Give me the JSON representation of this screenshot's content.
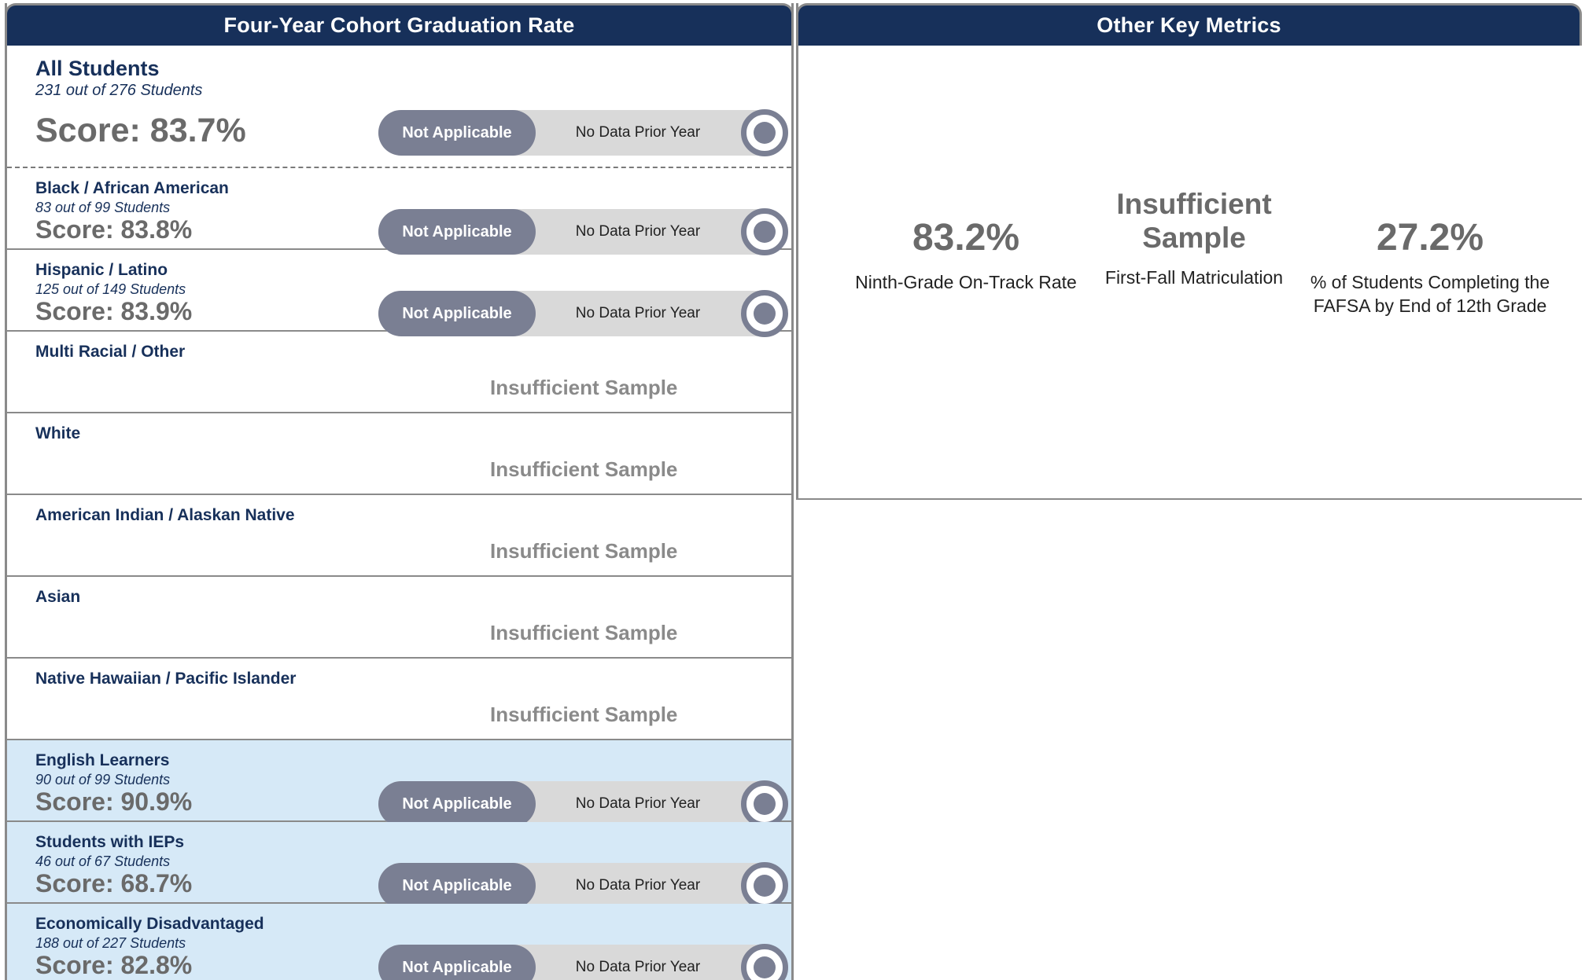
{
  "left_panel": {
    "title": "Four-Year Cohort Graduation Rate",
    "groups": [
      {
        "name": "All Students",
        "count": "231 out of 276 Students",
        "score": "Score: 83.7%",
        "na_label": "Not Applicable",
        "nodata_label": "No Data Prior Year"
      },
      {
        "name": "Black / African American",
        "count": "83 out of 99 Students",
        "score": "Score: 83.8%",
        "na_label": "Not Applicable",
        "nodata_label": "No Data Prior Year"
      },
      {
        "name": "Hispanic / Latino",
        "count": "125 out of 149 Students",
        "score": "Score: 83.9%",
        "na_label": "Not Applicable",
        "nodata_label": "No Data Prior Year"
      },
      {
        "name": "Multi Racial / Other",
        "insufficient": "Insufficient Sample"
      },
      {
        "name": "White",
        "insufficient": "Insufficient Sample"
      },
      {
        "name": "American Indian / Alaskan Native",
        "insufficient": "Insufficient Sample"
      },
      {
        "name": "Asian",
        "insufficient": "Insufficient Sample"
      },
      {
        "name": "Native Hawaiian / Pacific Islander",
        "insufficient": "Insufficient Sample"
      },
      {
        "name": "English Learners",
        "count": "90 out of 99 Students",
        "score": "Score: 90.9%",
        "na_label": "Not Applicable",
        "nodata_label": "No Data Prior Year"
      },
      {
        "name": "Students with IEPs",
        "count": "46 out of 67 Students",
        "score": "Score: 68.7%",
        "na_label": "Not Applicable",
        "nodata_label": "No Data Prior Year"
      },
      {
        "name": "Economically Disadvantaged",
        "count": "188 out of 227 Students",
        "score": "Score: 82.8%",
        "na_label": "Not Applicable",
        "nodata_label": "No Data Prior Year"
      }
    ]
  },
  "right_panel": {
    "title": "Other Key Metrics",
    "metrics": [
      {
        "value": "83.2%",
        "label": "Ninth-Grade On-Track Rate"
      },
      {
        "value_line1": "Insufficient",
        "value_line2": "Sample",
        "label": "First-Fall Matriculation"
      },
      {
        "value": "27.2%",
        "label_line1": "% of Students Completing the",
        "label_line2": "FAFSA by End of 12th Grade"
      }
    ]
  },
  "colors": {
    "header_bg": "#17305a",
    "highlight_row_bg": "#d6e9f7",
    "pill_dark": "#7a7f93",
    "pill_light": "#d9d9d9",
    "score_gray": "#6a6a6a"
  }
}
